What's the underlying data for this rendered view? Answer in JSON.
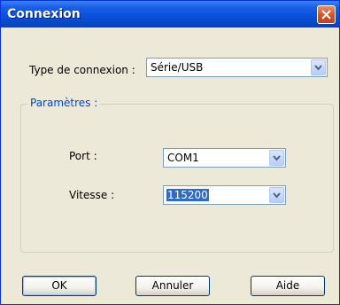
{
  "window": {
    "title": "Connexion"
  },
  "connection": {
    "label": "Type de connexion :",
    "value": "Série/USB"
  },
  "params": {
    "legend": "Paramètres :",
    "port_label": "Port :",
    "port_value": "COM1",
    "speed_label": "Vitesse :",
    "speed_value": "115200"
  },
  "buttons": {
    "ok": "OK",
    "cancel": "Annuler",
    "help": "Aide"
  },
  "colors": {
    "title_bar": "#0a4fd8",
    "selection": "#316ac5",
    "accent_text": "#0046d5"
  },
  "icons": {
    "close": "close-icon",
    "dropdown": "chevron-down-icon"
  }
}
